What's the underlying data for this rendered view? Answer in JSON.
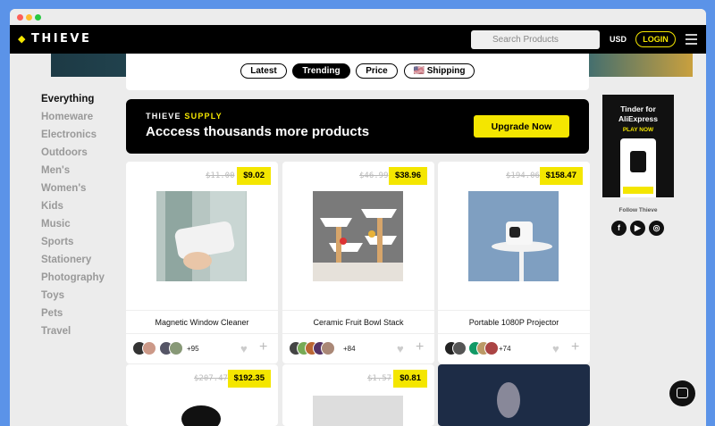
{
  "brand": {
    "name": "THIEVE",
    "gem": "◆"
  },
  "nav": {
    "search_placeholder": "Search Products",
    "currency": "USD",
    "login_label": "LOGIN"
  },
  "filters": [
    {
      "label": "Latest"
    },
    {
      "label": "Trending"
    },
    {
      "label": "Price"
    },
    {
      "label": "🇺🇸 Shipping"
    }
  ],
  "categories": [
    "Everything",
    "Homeware",
    "Electronics",
    "Outdoors",
    "Men's",
    "Women's",
    "Kids",
    "Music",
    "Sports",
    "Stationery",
    "Photography",
    "Toys",
    "Pets",
    "Travel"
  ],
  "banner": {
    "brand_a": "THIEVE",
    "brand_b": "SUPPLY",
    "headline": "Acccess thousands more products",
    "button": "Upgrade Now"
  },
  "products": [
    {
      "title": "Magnetic Window Cleaner",
      "old_price": "$11.00",
      "price": "$9.02",
      "extra": "+95"
    },
    {
      "title": "Ceramic Fruit Bowl Stack",
      "old_price": "$46.99",
      "price": "$38.96",
      "extra": "+84"
    },
    {
      "title": "Portable 1080P Projector",
      "old_price": "$194.06",
      "price": "$158.47",
      "extra": "+74"
    },
    {
      "title": "",
      "old_price": "$207.47",
      "price": "$192.35",
      "extra": ""
    },
    {
      "title": "",
      "old_price": "$1.57",
      "price": "$0.81",
      "extra": ""
    }
  ],
  "ad": {
    "line1": "Tinder for",
    "line2": "AliExpress",
    "cta": "PLAY NOW"
  },
  "follow": {
    "label": "Follow Thieve",
    "icons": [
      "facebook-icon",
      "youtube-icon",
      "instagram-icon"
    ]
  },
  "colors": {
    "accent": "#f4e600",
    "nav": "#000000",
    "bg": "#ececec"
  }
}
